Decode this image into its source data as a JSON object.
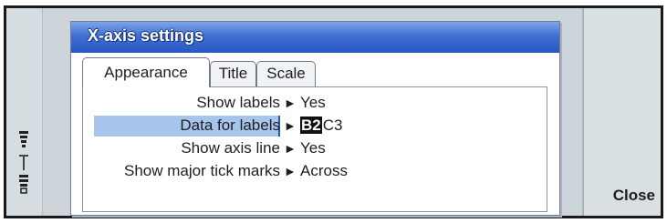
{
  "window": {
    "title": "X-axis settings"
  },
  "tabs": [
    {
      "label": "Appearance",
      "active": true
    },
    {
      "label": "Title",
      "active": false
    },
    {
      "label": "Scale",
      "active": false
    }
  ],
  "settings": [
    {
      "label": "Show labels",
      "value": "Yes"
    },
    {
      "label": "Data for labels",
      "value_selected": "B2",
      "value_rest": "C3",
      "selected": true
    },
    {
      "label": "Show axis line",
      "value": "Yes"
    },
    {
      "label": "Show major tick marks",
      "value": "Across"
    }
  ],
  "arrow_glyph": "►",
  "softkeys": {
    "close": "Close"
  },
  "status_icons": [
    "signal-strength-icon",
    "antenna-icon",
    "battery-level-icon"
  ],
  "colors": {
    "title_bar": "#3f6fd3",
    "selection": "#a6c4ec"
  }
}
